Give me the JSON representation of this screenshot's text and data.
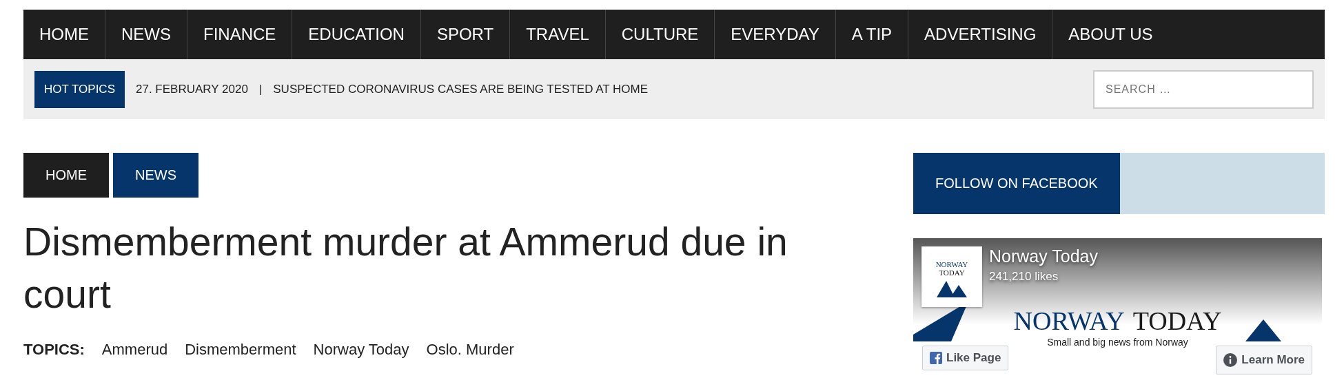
{
  "nav": {
    "items": [
      {
        "label": "HOME"
      },
      {
        "label": "NEWS"
      },
      {
        "label": "FINANCE"
      },
      {
        "label": "EDUCATION"
      },
      {
        "label": "SPORT"
      },
      {
        "label": "TRAVEL"
      },
      {
        "label": "CULTURE"
      },
      {
        "label": "EVERYDAY"
      },
      {
        "label": "A TIP"
      },
      {
        "label": "ADVERTISING"
      },
      {
        "label": "ABOUT US"
      }
    ]
  },
  "hot_topics": {
    "label": "HOT TOPICS",
    "date": "27. FEBRUARY 2020",
    "separator": "|",
    "headline": "SUSPECTED CORONAVIRUS CASES ARE BEING TESTED AT HOME"
  },
  "search": {
    "placeholder": "SEARCH …"
  },
  "breadcrumbs": [
    {
      "label": "HOME",
      "kind": "home"
    },
    {
      "label": "NEWS",
      "kind": "category"
    }
  ],
  "article": {
    "title": "Dismemberment murder at Ammerud due in court",
    "topics_label": "TOPICS:",
    "topics": [
      "Ammerud",
      "Dismemberment",
      "Norway Today",
      "Oslo. Murder"
    ]
  },
  "sidebar": {
    "heading": "FOLLOW ON FACEBOOK",
    "facebook": {
      "logo_lines": [
        "NORWAY",
        "TODAY"
      ],
      "page_name": "Norway Today",
      "likes": "241,210 likes",
      "banner_words": [
        "NORWAY",
        "TODAY"
      ],
      "tagline": "Small and big news from Norway",
      "like_button": "Like Page",
      "learn_button": "Learn More"
    }
  }
}
